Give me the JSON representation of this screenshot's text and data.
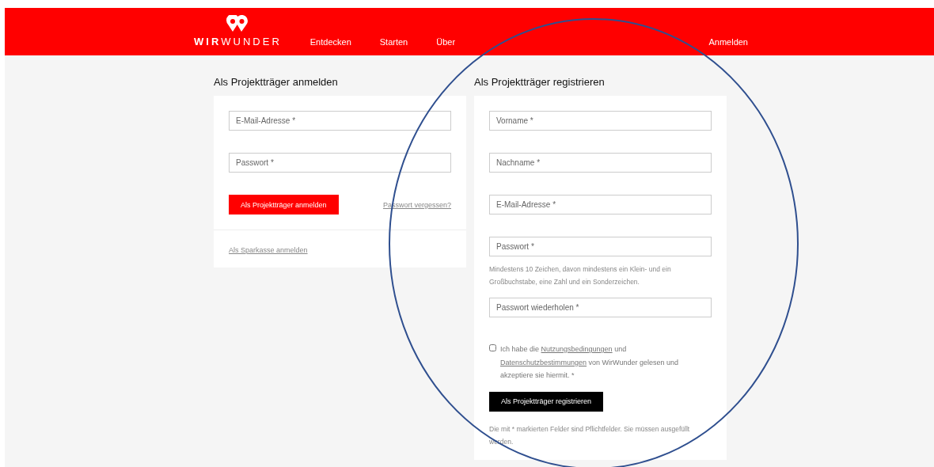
{
  "header": {
    "logo_text": "**WIR**WUNDER",
    "nav": [
      {
        "label": "Entdecken"
      },
      {
        "label": "Starten"
      },
      {
        "label": "Über"
      }
    ],
    "login_link": "Anmelden"
  },
  "login": {
    "title": "Als Projektträger anmelden",
    "fields": [
      {
        "placeholder": "E-Mail-Adresse *"
      },
      {
        "placeholder": "Passwort *"
      }
    ],
    "submit": "Als Projektträger anmelden",
    "forgot_link": "Passwort vergessen?",
    "sparkasse_link": "Als Sparkasse anmelden"
  },
  "register": {
    "title": "Als Projektträger registrieren",
    "fields": [
      {
        "placeholder": "Vorname *"
      },
      {
        "placeholder": "Nachname *"
      },
      {
        "placeholder": "E-Mail-Adresse *"
      },
      {
        "placeholder": "Passwort *",
        "hint": "Mindestens 10 Zeichen, davon mindestens ein Klein- und ein Großbuchstabe, eine Zahl und ein Sonderzeichen."
      },
      {
        "placeholder": "Passwort wiederholen *"
      }
    ],
    "consent": {
      "checked": false,
      "before": "Ich habe die",
      "link1": "Nutzungsbedingungen",
      "middle": "und",
      "link2": "Datenschutzbestimmungen",
      "after": "von WirWunder gelesen und akzeptiere sie hiermit. *"
    },
    "submit": "Als Projektträger registrieren",
    "note": "Die mit * markierten Felder sind Pflichtfelder. Sie müssen ausgefüllt werden."
  }
}
